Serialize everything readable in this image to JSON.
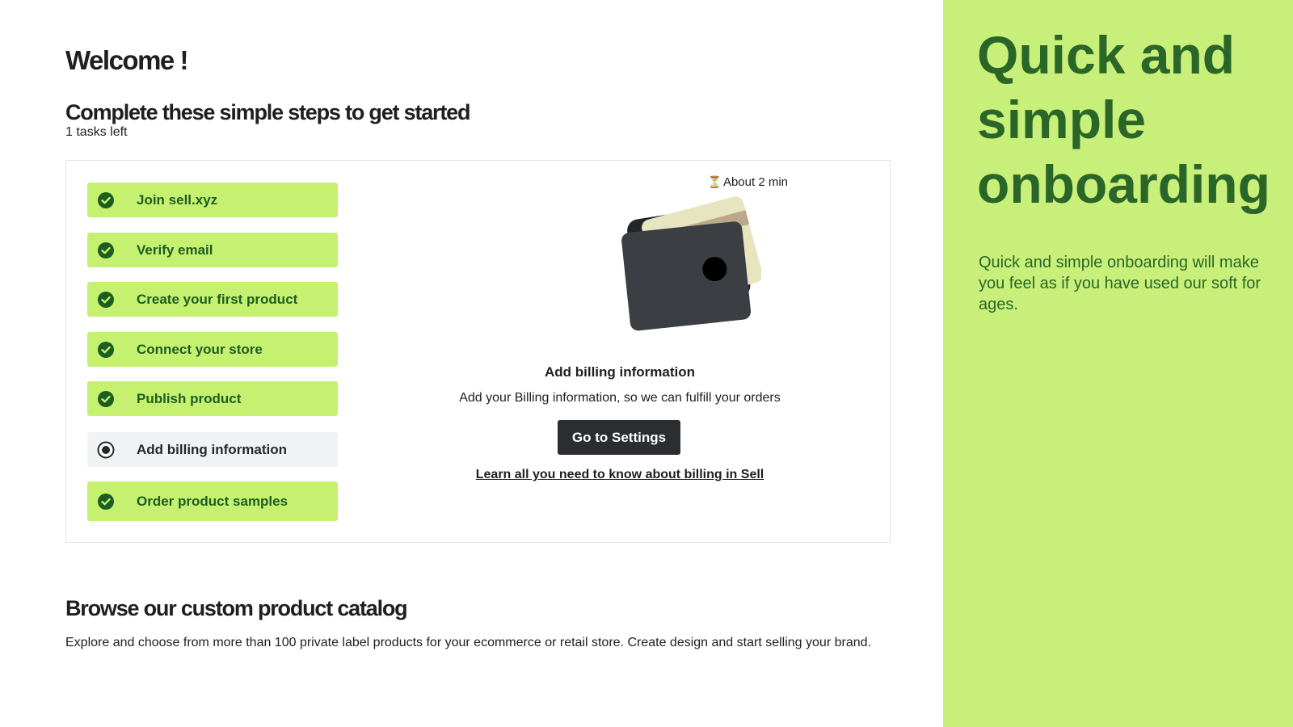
{
  "main": {
    "welcome": "Welcome !",
    "subheading": "Complete these simple steps to get started",
    "tasks_left": "1 tasks left"
  },
  "checklist": {
    "steps": [
      {
        "label": "Join sell.xyz",
        "status": "done",
        "icon": "check-circle-icon"
      },
      {
        "label": "Verify email",
        "status": "done",
        "icon": "check-circle-icon"
      },
      {
        "label": "Create your first product",
        "status": "done",
        "icon": "check-circle-icon"
      },
      {
        "label": "Connect your store",
        "status": "done",
        "icon": "check-circle-icon"
      },
      {
        "label": "Publish product",
        "status": "done",
        "icon": "check-circle-icon"
      },
      {
        "label": "Add billing information",
        "status": "current",
        "icon": "radio-selected-icon"
      },
      {
        "label": "Order product samples",
        "status": "done",
        "icon": "check-circle-icon"
      }
    ]
  },
  "detail": {
    "duration_icon": "hourglass-icon",
    "duration_glyph": "⏳",
    "duration": "About 2 min",
    "illustration": "wallet-icon",
    "title": "Add billing information",
    "description": "Add your Billing information, so we can fulfill your orders",
    "button_label": "Go to Settings",
    "link_label": "Learn all you need to know about billing in Sell"
  },
  "catalog": {
    "title": "Browse our custom product catalog",
    "description": "Explore and choose from more than 100 private label products for your ecommerce or retail store. Create design and start selling your brand."
  },
  "side_panel": {
    "title": "Quick and simple onboarding",
    "text": "Quick and simple onboarding will make you feel as if you have used our soft for ages."
  },
  "colors": {
    "accent_green": "#c6f06f",
    "panel_green": "#c8ef7a",
    "dark_green": "#1b5e20",
    "panel_text_green": "#2a6628",
    "button_dark": "#2b2d31",
    "current_step_bg": "#f1f2f4"
  }
}
